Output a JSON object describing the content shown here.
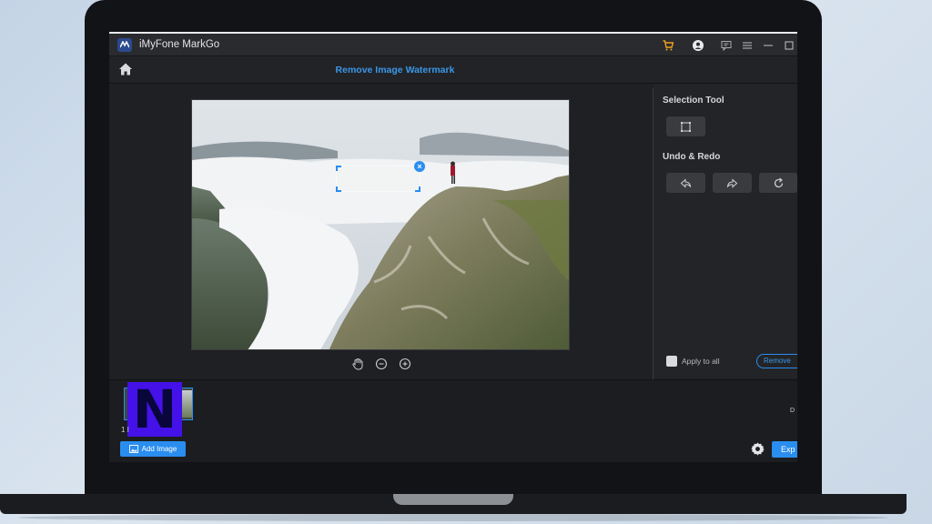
{
  "app": {
    "title": "iMyFone MarkGo"
  },
  "navbar": {
    "title": "Remove Image Watermark"
  },
  "right_panel": {
    "selection_heading": "Selection Tool",
    "undo_heading": "Undo & Redo",
    "apply_all_label": "Apply to all",
    "remove_button": "Remove"
  },
  "bottom": {
    "image_count": "1 I",
    "right_label": "D",
    "add_image_label": "Add Image",
    "export_label": "Exp"
  },
  "overlay": {
    "logo_letter": "N"
  },
  "colors": {
    "accent": "#2a8df0",
    "title_blue": "#3a97e8",
    "background": "#1f2023",
    "cart": "#f0a020",
    "logo_purple": "#4411e8"
  },
  "icons": [
    "app-logo-icon",
    "cart-icon",
    "user-icon",
    "feedback-icon",
    "menu-icon",
    "minimize-icon",
    "maximize-icon",
    "home-icon",
    "hand-icon",
    "zoom-out-icon",
    "zoom-in-icon",
    "rectangle-select-icon",
    "undo-icon",
    "redo-icon",
    "reset-icon",
    "image-icon",
    "settings-icon"
  ]
}
